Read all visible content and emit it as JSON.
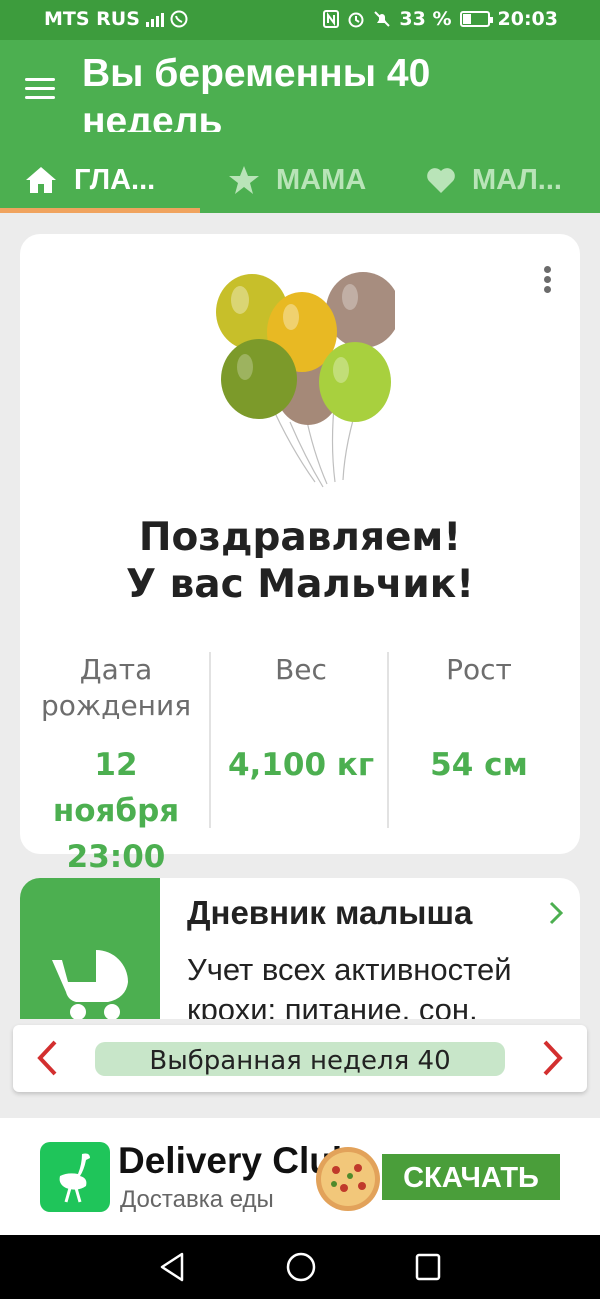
{
  "status_bar": {
    "carrier": "MTS RUS",
    "network": "4G",
    "battery": "33 %",
    "battery_level": 0.33,
    "time": "20:03"
  },
  "app_bar": {
    "title": "Вы беременны 40 недель",
    "tabs": [
      {
        "label": "ГЛА...",
        "icon": "home-icon",
        "active": true
      },
      {
        "label": "МАМА",
        "icon": "star-icon",
        "active": false
      },
      {
        "label": "МАЛ...",
        "icon": "heart-icon",
        "active": false
      }
    ]
  },
  "main_card": {
    "congrats_line1": "Поздравляем!",
    "congrats_line2": "У вас Мальчик!",
    "stats": [
      {
        "label": "Дата рождения",
        "value": "12 ноября 23:00"
      },
      {
        "label": "Вес",
        "value": "4,100 кг"
      },
      {
        "label": "Рост",
        "value": "54 см"
      }
    ]
  },
  "diary": {
    "title": "Дневник малыша",
    "description": "Учет всех активностей крохи: питание, сон,"
  },
  "week_selector": {
    "label": "Выбранная неделя 40"
  },
  "ad": {
    "brand": "Delivery Club",
    "subtitle": "Доставка еды",
    "button": "СКАЧАТЬ"
  },
  "colors": {
    "primary": "#4caf50",
    "status_bar": "#3d9c3d",
    "accent": "#f0a35e",
    "arrow": "#d32f2f"
  }
}
